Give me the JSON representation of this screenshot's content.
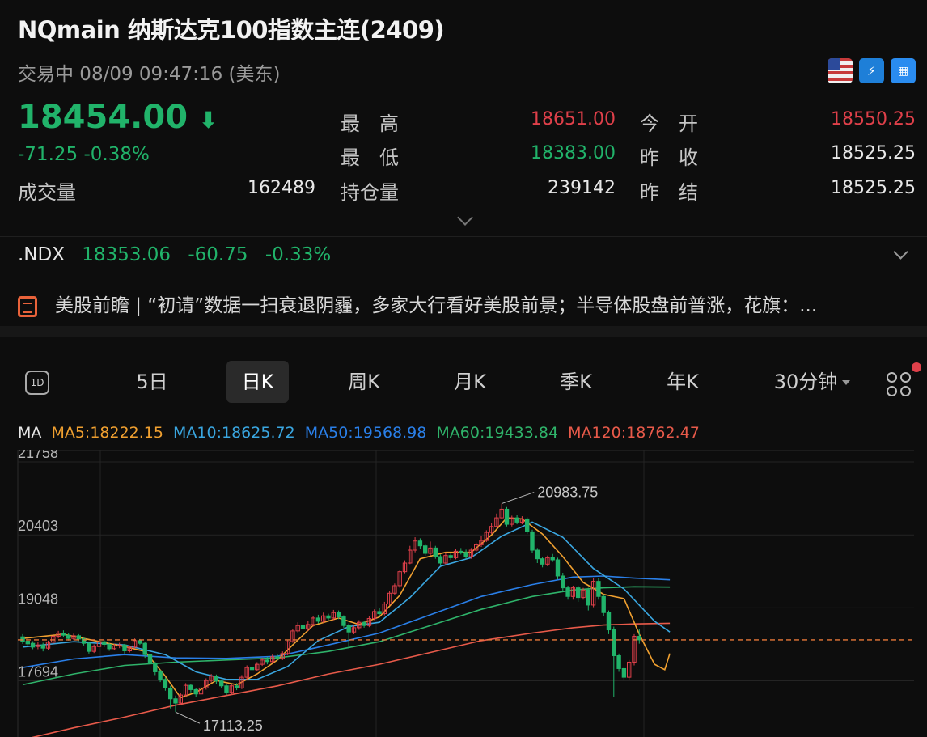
{
  "header": {
    "title": "NQmain  纳斯达克100指数主连(2409)",
    "status": "交易中   08/09 09:47:16 (美东)",
    "icons": [
      "us-flag-icon",
      "level2-icon",
      "bank-icon"
    ]
  },
  "quote": {
    "price": "18454.00",
    "direction_arrow": "⬇",
    "change": "-71.25",
    "change_pct": "-0.38%",
    "volume_label": "成交量",
    "volume": "162489",
    "high_label": "最　高",
    "high": "18651.00",
    "low_label": "最　低",
    "low": "18383.00",
    "oi_label": "持仓量",
    "oi": "239142",
    "open_label": "今　开",
    "open": "18550.25",
    "prev_close_label": "昨　收",
    "prev_close": "18525.25",
    "prev_settle_label": "昨　结",
    "prev_settle": "18525.25"
  },
  "index": {
    "symbol": ".NDX",
    "price": "18353.06",
    "change": "-60.75",
    "change_pct": "-0.33%"
  },
  "news": {
    "text": "美股前瞻 | “初请”数据一扫衰退阴霾，多家大行看好美股前景；半导体股盘前普涨，花旗：..."
  },
  "tabs": {
    "t1d": "1D",
    "t5d": "5日",
    "day": "日K",
    "week": "周K",
    "month": "月K",
    "quarter": "季K",
    "year": "年K",
    "interval": "30分钟"
  },
  "ma": {
    "label": "MA",
    "ma5": "MA5:18222.15",
    "ma10": "MA10:18625.72",
    "ma50": "MA50:19568.98",
    "ma60": "MA60:19433.84",
    "ma120": "MA120:18762.47"
  },
  "colors": {
    "up": "#e0404a",
    "down": "#21b36a",
    "ma5": "#f0a030",
    "ma10": "#3aa6e0",
    "ma50": "#2a7fe8",
    "ma60": "#2fb36a",
    "ma120": "#e85a4a",
    "ref_line": "#e8783a"
  },
  "chart_data": {
    "type": "candlestick",
    "y_ticks": [
      "21758",
      "20403",
      "19048",
      "17694"
    ],
    "ylim": [
      16650,
      21758
    ],
    "annotations": {
      "high": "20983.75",
      "low": "17113.25"
    },
    "reference_price": 18454,
    "candles": [
      [
        18510,
        18420,
        18560,
        18380
      ],
      [
        18430,
        18380,
        18470,
        18330
      ],
      [
        18390,
        18320,
        18430,
        18280
      ],
      [
        18330,
        18360,
        18410,
        18280
      ],
      [
        18360,
        18300,
        18400,
        18240
      ],
      [
        18300,
        18410,
        18440,
        18260
      ],
      [
        18410,
        18520,
        18560,
        18380
      ],
      [
        18520,
        18580,
        18620,
        18480
      ],
      [
        18580,
        18540,
        18630,
        18500
      ],
      [
        18540,
        18480,
        18580,
        18440
      ],
      [
        18480,
        18530,
        18570,
        18450
      ],
      [
        18530,
        18470,
        18560,
        18430
      ],
      [
        18470,
        18390,
        18500,
        18350
      ],
      [
        18390,
        18240,
        18420,
        18200
      ],
      [
        18240,
        18330,
        18370,
        18210
      ],
      [
        18330,
        18420,
        18460,
        18300
      ],
      [
        18420,
        18370,
        18450,
        18320
      ],
      [
        18370,
        18290,
        18400,
        18250
      ],
      [
        18290,
        18340,
        18380,
        18260
      ],
      [
        18340,
        18360,
        18400,
        18300
      ],
      [
        18360,
        18250,
        18380,
        18200
      ],
      [
        18250,
        18320,
        18350,
        18220
      ],
      [
        18320,
        18440,
        18480,
        18290
      ],
      [
        18440,
        18390,
        18470,
        18360
      ],
      [
        18390,
        18180,
        18420,
        18120
      ],
      [
        18180,
        18020,
        18210,
        17970
      ],
      [
        18020,
        17860,
        18050,
        17800
      ],
      [
        17860,
        17720,
        17900,
        17670
      ],
      [
        17720,
        17560,
        17760,
        17510
      ],
      [
        17560,
        17360,
        17600,
        17180
      ],
      [
        17360,
        17280,
        17420,
        17113.25
      ],
      [
        17280,
        17430,
        17470,
        17250
      ],
      [
        17430,
        17610,
        17650,
        17400
      ],
      [
        17610,
        17530,
        17640,
        17480
      ],
      [
        17530,
        17450,
        17560,
        17400
      ],
      [
        17450,
        17560,
        17600,
        17420
      ],
      [
        17560,
        17700,
        17740,
        17530
      ],
      [
        17700,
        17780,
        17820,
        17660
      ],
      [
        17780,
        17690,
        17810,
        17640
      ],
      [
        17690,
        17600,
        17720,
        17560
      ],
      [
        17600,
        17480,
        17630,
        17430
      ],
      [
        17480,
        17600,
        17640,
        17440
      ],
      [
        17600,
        17560,
        17650,
        17520
      ],
      [
        17560,
        17760,
        17800,
        17540
      ],
      [
        17760,
        17940,
        17980,
        17720
      ],
      [
        17940,
        17900,
        17990,
        17850
      ],
      [
        17900,
        18000,
        18040,
        17870
      ],
      [
        18000,
        18080,
        18120,
        17970
      ],
      [
        18080,
        18050,
        18140,
        18000
      ],
      [
        18050,
        18140,
        18180,
        18020
      ],
      [
        18140,
        18110,
        18180,
        18070
      ],
      [
        18110,
        18200,
        18240,
        18080
      ],
      [
        18200,
        18420,
        18460,
        18170
      ],
      [
        18420,
        18620,
        18660,
        18400
      ],
      [
        18620,
        18720,
        18780,
        18590
      ],
      [
        18720,
        18660,
        18760,
        18610
      ],
      [
        18660,
        18740,
        18800,
        18620
      ],
      [
        18740,
        18860,
        18900,
        18700
      ],
      [
        18860,
        18800,
        18920,
        18760
      ],
      [
        18800,
        18900,
        18960,
        18770
      ],
      [
        18900,
        18860,
        18940,
        18820
      ],
      [
        18860,
        18960,
        19010,
        18820
      ],
      [
        18960,
        18880,
        19000,
        18840
      ],
      [
        18880,
        18720,
        18910,
        18680
      ],
      [
        18720,
        18600,
        18760,
        18300
      ],
      [
        18600,
        18680,
        18720,
        18560
      ],
      [
        18680,
        18780,
        18820,
        18640
      ],
      [
        18780,
        18720,
        18810,
        18680
      ],
      [
        18720,
        18850,
        18890,
        18690
      ],
      [
        18850,
        18980,
        19020,
        18820
      ],
      [
        18980,
        18940,
        19040,
        18900
      ],
      [
        18940,
        19120,
        19160,
        18910
      ],
      [
        19120,
        19320,
        19360,
        19090
      ],
      [
        19320,
        19460,
        19500,
        19280
      ],
      [
        19460,
        19720,
        19760,
        19420
      ],
      [
        19720,
        19880,
        19930,
        19690
      ],
      [
        19880,
        20120,
        20200,
        19860
      ],
      [
        20120,
        20290,
        20360,
        20080
      ],
      [
        20290,
        20200,
        20340,
        20150
      ],
      [
        20200,
        20060,
        20240,
        20010
      ],
      [
        20060,
        20160,
        20280,
        20020
      ],
      [
        20160,
        20000,
        20200,
        19960
      ],
      [
        20000,
        19880,
        20040,
        19840
      ],
      [
        19880,
        20020,
        20080,
        19860
      ],
      [
        20020,
        19980,
        20060,
        19940
      ],
      [
        19980,
        20100,
        20140,
        19950
      ],
      [
        20100,
        20080,
        20160,
        20040
      ],
      [
        20080,
        20000,
        20130,
        19960
      ],
      [
        20000,
        20120,
        20160,
        19960
      ],
      [
        20120,
        20220,
        20260,
        20080
      ],
      [
        20220,
        20300,
        20380,
        20180
      ],
      [
        20300,
        20450,
        20490,
        20270
      ],
      [
        20450,
        20560,
        20620,
        20420
      ],
      [
        20560,
        20720,
        20800,
        20540
      ],
      [
        20720,
        20880,
        20983.75,
        20700
      ],
      [
        20880,
        20600,
        20920,
        20560
      ],
      [
        20600,
        20720,
        20760,
        20560
      ],
      [
        20720,
        20640,
        20770,
        20600
      ],
      [
        20640,
        20700,
        20750,
        20600
      ],
      [
        20700,
        20460,
        20730,
        20420
      ],
      [
        20460,
        20120,
        20500,
        20060
      ],
      [
        20120,
        19960,
        20160,
        19880
      ],
      [
        19960,
        19860,
        20000,
        19800
      ],
      [
        19860,
        19980,
        20020,
        19820
      ],
      [
        19980,
        19940,
        20050,
        19900
      ],
      [
        19940,
        19640,
        19980,
        19580
      ],
      [
        19640,
        19420,
        19700,
        19360
      ],
      [
        19420,
        19260,
        19460,
        19200
      ],
      [
        19260,
        19420,
        19460,
        19200
      ],
      [
        19420,
        19240,
        19460,
        19160
      ],
      [
        19240,
        19380,
        19420,
        19200
      ],
      [
        19380,
        19100,
        19420,
        19000
      ],
      [
        19100,
        19540,
        19600,
        19060
      ],
      [
        19540,
        19260,
        19600,
        19200
      ],
      [
        19260,
        18960,
        19300,
        18900
      ],
      [
        18960,
        18640,
        19000,
        18560
      ],
      [
        18640,
        18160,
        18700,
        17400
      ],
      [
        18160,
        17920,
        18200,
        17860
      ],
      [
        17920,
        17760,
        17960,
        17700
      ],
      [
        17760,
        18040,
        18080,
        17720
      ],
      [
        18040,
        18520,
        18560,
        17980
      ],
      [
        18520,
        18454,
        18651,
        18383
      ]
    ],
    "ma5": [
      [
        0,
        18480
      ],
      [
        8,
        18560
      ],
      [
        12,
        18480
      ],
      [
        20,
        18330
      ],
      [
        24,
        18240
      ],
      [
        28,
        17780
      ],
      [
        31,
        17380
      ],
      [
        34,
        17480
      ],
      [
        38,
        17700
      ],
      [
        42,
        17620
      ],
      [
        46,
        17820
      ],
      [
        50,
        18080
      ],
      [
        53,
        18360
      ],
      [
        57,
        18720
      ],
      [
        62,
        18860
      ],
      [
        66,
        18740
      ],
      [
        70,
        18880
      ],
      [
        74,
        19280
      ],
      [
        78,
        19960
      ],
      [
        83,
        20080
      ],
      [
        88,
        20080
      ],
      [
        92,
        20400
      ],
      [
        95,
        20720
      ],
      [
        98,
        20700
      ],
      [
        102,
        20420
      ],
      [
        106,
        20000
      ],
      [
        110,
        19520
      ],
      [
        114,
        19300
      ],
      [
        118,
        19220
      ],
      [
        121,
        18560
      ],
      [
        124,
        18000
      ],
      [
        126,
        17900
      ],
      [
        127,
        18200
      ]
    ],
    "ma10": [
      [
        0,
        18320
      ],
      [
        10,
        18420
      ],
      [
        20,
        18360
      ],
      [
        28,
        18180
      ],
      [
        34,
        17860
      ],
      [
        40,
        17720
      ],
      [
        46,
        17720
      ],
      [
        52,
        17960
      ],
      [
        58,
        18440
      ],
      [
        64,
        18700
      ],
      [
        70,
        18780
      ],
      [
        76,
        19240
      ],
      [
        82,
        19820
      ],
      [
        88,
        19980
      ],
      [
        94,
        20380
      ],
      [
        100,
        20640
      ],
      [
        106,
        20360
      ],
      [
        112,
        19780
      ],
      [
        118,
        19400
      ],
      [
        124,
        18800
      ],
      [
        127,
        18600
      ]
    ],
    "ma50": [
      [
        0,
        17940
      ],
      [
        10,
        18100
      ],
      [
        20,
        18180
      ],
      [
        30,
        18120
      ],
      [
        40,
        18110
      ],
      [
        50,
        18150
      ],
      [
        60,
        18360
      ],
      [
        70,
        18580
      ],
      [
        80,
        18920
      ],
      [
        90,
        19260
      ],
      [
        100,
        19480
      ],
      [
        108,
        19620
      ],
      [
        114,
        19640
      ],
      [
        120,
        19600
      ],
      [
        127,
        19568.98
      ]
    ],
    "ma60": [
      [
        0,
        17620
      ],
      [
        10,
        17820
      ],
      [
        20,
        17980
      ],
      [
        30,
        18040
      ],
      [
        40,
        18080
      ],
      [
        50,
        18120
      ],
      [
        60,
        18240
      ],
      [
        70,
        18420
      ],
      [
        80,
        18720
      ],
      [
        90,
        19020
      ],
      [
        100,
        19260
      ],
      [
        108,
        19380
      ],
      [
        114,
        19420
      ],
      [
        120,
        19440
      ],
      [
        127,
        19433.84
      ]
    ],
    "ma120": [
      [
        0,
        16600
      ],
      [
        10,
        16820
      ],
      [
        20,
        17020
      ],
      [
        30,
        17240
      ],
      [
        40,
        17420
      ],
      [
        50,
        17600
      ],
      [
        60,
        17820
      ],
      [
        70,
        18000
      ],
      [
        80,
        18220
      ],
      [
        90,
        18440
      ],
      [
        100,
        18580
      ],
      [
        108,
        18680
      ],
      [
        114,
        18730
      ],
      [
        120,
        18750
      ],
      [
        127,
        18762.47
      ]
    ]
  }
}
